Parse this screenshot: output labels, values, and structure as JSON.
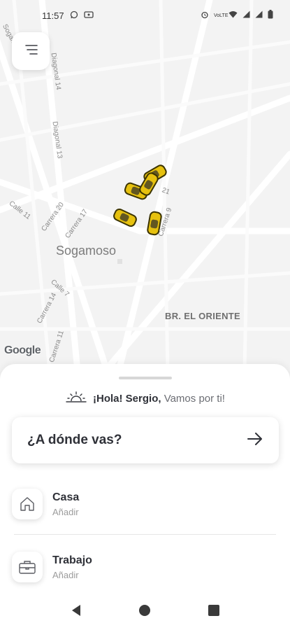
{
  "status_bar": {
    "time": "11:57",
    "left_icons": [
      "whatsapp-icon",
      "cast-icon"
    ],
    "right_icons": [
      "alarm-icon",
      "volte-icon",
      "wifi-icon",
      "signal-icon",
      "signal-icon",
      "battery-icon"
    ],
    "volte_text": "VoLTE"
  },
  "map": {
    "city": "Sogamoso",
    "district": "BR. EL ORIENTE",
    "street_labels": [
      "Sogamo",
      "Diagonal 14",
      "Diagonal 13",
      "Calle 11",
      "Carrera 20",
      "Carrera 17",
      "Carrera 9",
      "21",
      "Calle 7",
      "Carrera 14",
      "Carrera 11"
    ],
    "attribution": "Google",
    "taxi_icon": "taxi-icon",
    "taxi_color": "#e6c10f"
  },
  "menu": {
    "icon": "menu-icon"
  },
  "sheet": {
    "greeting_name": "¡Hola! Sergio,",
    "greeting_rest": "Vamos por ti!",
    "greeting_icon": "sunrise-icon",
    "destination_prompt": "¿A dónde vas?",
    "destination_icon": "arrow-right-icon",
    "places": [
      {
        "title": "Casa",
        "subtitle": "Añadir",
        "icon": "home-icon"
      },
      {
        "title": "Trabajo",
        "subtitle": "Añadir",
        "icon": "briefcase-icon"
      }
    ]
  },
  "nav": {
    "back_icon": "back-icon",
    "home_icon": "home-circle-icon",
    "recents_icon": "recents-icon"
  }
}
